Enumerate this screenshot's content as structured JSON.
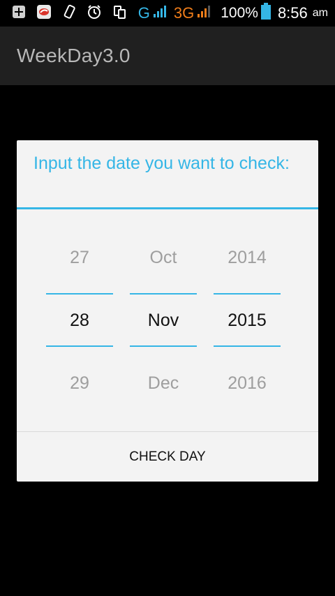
{
  "status_bar": {
    "network_g": "G",
    "network_3g": "3G",
    "battery": "100%",
    "time": "8:56",
    "ampm": "am",
    "icons": [
      "plus-box-icon",
      "app-badge-icon",
      "vibrate-icon",
      "alarm-icon",
      "data-transfer-icon"
    ]
  },
  "action_bar": {
    "title": "WeekDay3.0"
  },
  "dialog": {
    "title": "Input the date you want to check:",
    "picker": {
      "day": {
        "prev": "27",
        "selected": "28",
        "next": "29"
      },
      "month": {
        "prev": "Oct",
        "selected": "Nov",
        "next": "Dec"
      },
      "year": {
        "prev": "2014",
        "selected": "2015",
        "next": "2016"
      }
    },
    "button_label": "CHECK DAY"
  },
  "colors": {
    "accent": "#35b6e6",
    "dialog_bg": "#f3f3f3",
    "actionbar_bg": "#202020"
  }
}
